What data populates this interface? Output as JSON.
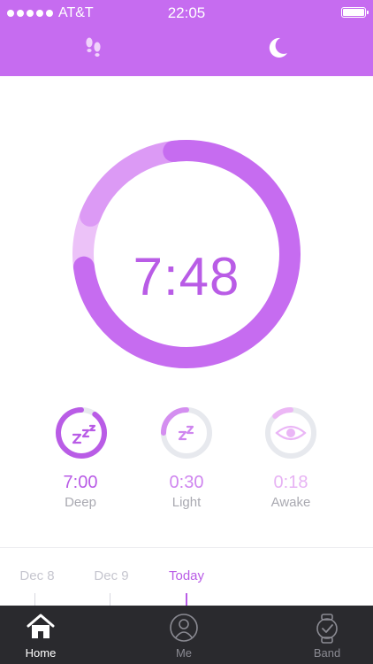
{
  "status_bar": {
    "carrier": "AT&T",
    "time": "22:05"
  },
  "header": {
    "tabs": [
      {
        "icon": "footsteps-icon",
        "active": false
      },
      {
        "icon": "moon-icon",
        "active": true
      }
    ]
  },
  "sleep": {
    "total": "7:48",
    "ring_fraction_deep": 0.75,
    "ring_fraction_light": 0.17,
    "ring_fraction_awake": 0.08,
    "stats": [
      {
        "value": "7:00",
        "label": "Deep",
        "icon": "zzz-icon",
        "fraction": 0.9,
        "color": "#b95ce6"
      },
      {
        "value": "0:30",
        "label": "Light",
        "icon": "zz-icon",
        "fraction": 0.25,
        "color": "#d48ef0"
      },
      {
        "value": "0:18",
        "label": "Awake",
        "icon": "eye-icon",
        "fraction": 0.12,
        "color": "#ecb7f5"
      }
    ]
  },
  "timeline": {
    "days": [
      {
        "label": "Dec 8",
        "active": false
      },
      {
        "label": "Dec 9",
        "active": false
      },
      {
        "label": "Today",
        "active": true
      }
    ]
  },
  "tabbar": {
    "items": [
      {
        "label": "Home",
        "icon": "home-icon",
        "active": true
      },
      {
        "label": "Me",
        "icon": "person-icon",
        "active": false
      },
      {
        "label": "Band",
        "icon": "watch-icon",
        "active": false
      }
    ]
  },
  "colors": {
    "accent": "#c66cf0",
    "accent_dark": "#b95ce6",
    "light": "#dc9af5",
    "pale": "#ecc2f8",
    "track": "#e7e9ee",
    "tabbar": "#2a2a2e"
  }
}
